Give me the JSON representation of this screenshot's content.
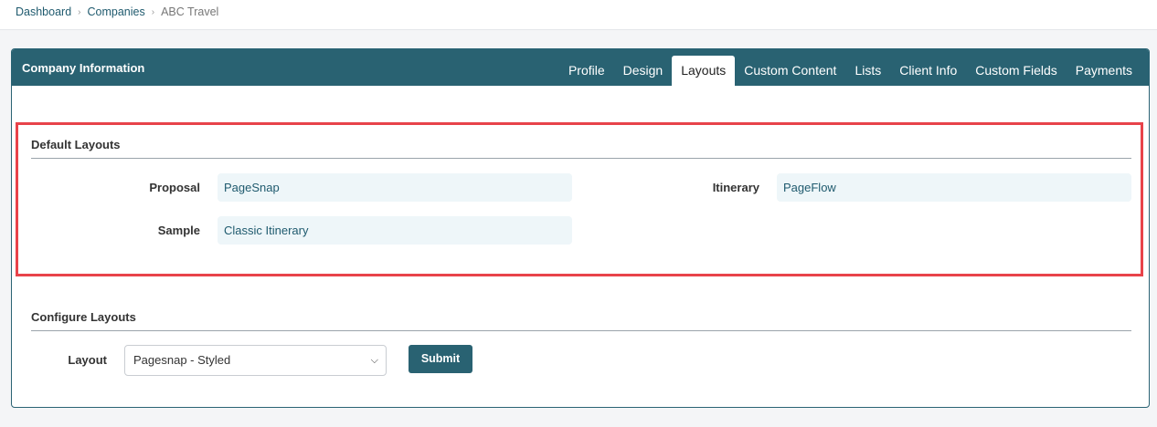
{
  "breadcrumb": {
    "items": [
      "Dashboard",
      "Companies"
    ],
    "current": "ABC Travel"
  },
  "card": {
    "title": "Company Information",
    "tabs": [
      {
        "label": "Profile"
      },
      {
        "label": "Design"
      },
      {
        "label": "Layouts",
        "active": true
      },
      {
        "label": "Custom Content"
      },
      {
        "label": "Lists"
      },
      {
        "label": "Client Info"
      },
      {
        "label": "Custom Fields"
      },
      {
        "label": "Payments"
      }
    ]
  },
  "default_layouts": {
    "title": "Default Layouts",
    "proposal_label": "Proposal",
    "proposal_value": "PageSnap",
    "itinerary_label": "Itinerary",
    "itinerary_value": "PageFlow",
    "sample_label": "Sample",
    "sample_value": "Classic Itinerary"
  },
  "configure_layouts": {
    "title": "Configure Layouts",
    "layout_label": "Layout",
    "layout_selected": "Pagesnap - Styled",
    "submit_label": "Submit"
  },
  "colors": {
    "header": "#296272",
    "highlight": "#e8434a",
    "value_bg": "#eef6f9"
  }
}
